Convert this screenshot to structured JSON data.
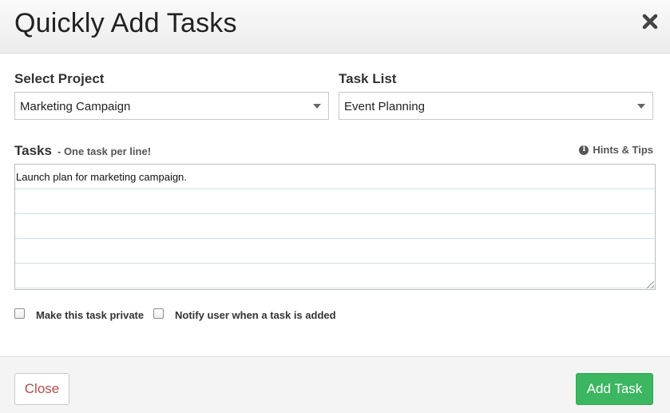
{
  "dialog": {
    "title": "Quickly Add Tasks",
    "close_icon": "close-icon"
  },
  "project": {
    "label": "Select Project",
    "selected": "Marketing Campaign"
  },
  "task_list": {
    "label": "Task List",
    "selected": "Event Planning"
  },
  "tasks": {
    "label": "Tasks",
    "hint": "- One task per line!",
    "hints_link": "Hints & Tips",
    "hints_icon": "info-icon",
    "lines": [
      "Launch plan for marketing campaign.",
      "",
      "",
      "",
      ""
    ]
  },
  "options": {
    "private_label": "Make this task private",
    "private_checked": false,
    "notify_label": "Notify user when a task is added",
    "notify_checked": false
  },
  "footer": {
    "close_label": "Close",
    "add_label": "Add Task"
  },
  "colors": {
    "add_button": "#3cb660",
    "close_text": "#b94a48"
  }
}
